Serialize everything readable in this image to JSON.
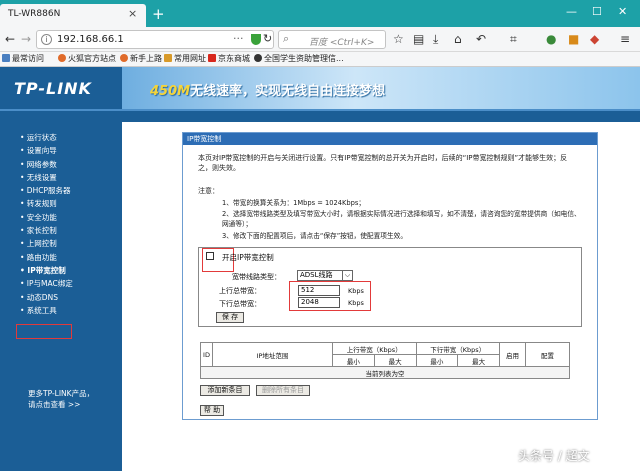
{
  "browser": {
    "tab_title": "TL-WR886N",
    "tab_close": "×",
    "new_tab": "+",
    "win_min": "—",
    "win_max": "☐",
    "win_close": "✕",
    "url": "192.168.66.1",
    "url_more": "···",
    "search_placeholder": "百度 <Ctrl+K>",
    "bookmarks": [
      {
        "label": "最常访问",
        "color": "#4a7fc0"
      },
      {
        "label": "火狐官方站点",
        "color": "#e06b2a"
      },
      {
        "label": "新手上路",
        "color": "#e06b2a"
      },
      {
        "label": "常用网址",
        "color": "#d89a2a"
      },
      {
        "label": "京东商城",
        "color": "#d8281e"
      },
      {
        "label": "全国学生资助管理信...",
        "color": "#333333"
      }
    ]
  },
  "router": {
    "logo": "TP-LINK",
    "slogan_num": "450M",
    "slogan": "无线速率，实现无线自由连接梦想",
    "sidebar": [
      {
        "label": "• 运行状态"
      },
      {
        "label": "• 设置向导"
      },
      {
        "label": "• 网络参数"
      },
      {
        "label": "• 无线设置"
      },
      {
        "label": "• DHCP服务器"
      },
      {
        "label": "• 转发规则"
      },
      {
        "label": "• 安全功能"
      },
      {
        "label": "• 家长控制"
      },
      {
        "label": "• 上网控制"
      },
      {
        "label": "• 路由功能"
      },
      {
        "label": "• IP带宽控制"
      },
      {
        "label": "• IP与MAC绑定"
      },
      {
        "label": "• 动态DNS"
      },
      {
        "label": "• 系统工具"
      }
    ],
    "sidebar_more_1": "更多TP-LINK产品，",
    "sidebar_more_2": "请点击查看 >>",
    "section_title": "IP带宽控制",
    "intro": "本页对IP带宽控制的开启与关闭进行设置。只有IP带宽控制的总开关为开启时，后续的“IP带宽控制规则”才能够生效；反之，则失效。",
    "notes_title": "注意：",
    "notes": [
      "1、带宽的换算关系为：1Mbps = 1024Kbps；",
      "2、选择宽带线路类型及填写带宽大小时，请根据实际情况进行选择和填写，如不清楚，请咨询您的宽带提供商（如电信、网通等）；",
      "3、修改下面的配置项后，请点击“保存”按钮，使配置项生效。"
    ],
    "enable_label": "开启IP带宽控制",
    "enable_checked": false,
    "line_type_label": "宽带线路类型：",
    "line_type_value": "ADSL线路",
    "up_label": "上行总带宽：",
    "up_value": "512",
    "down_label": "下行总带宽：",
    "down_value": "2048",
    "unit": "Kbps",
    "save_button": "保 存",
    "table": {
      "col_id": "ID",
      "col_range": "IP地址范围",
      "col_up": "上行带宽（Kbps）",
      "col_down": "下行带宽（Kbps）",
      "col_enable": "启用",
      "col_config": "配置",
      "min": "最小",
      "max": "最大",
      "empty": "当前列表为空"
    },
    "add_button": "添加新条目",
    "delete_all_button": "删除所有条目",
    "help_button": "帮 助"
  },
  "watermark": "头条号 / 超文"
}
